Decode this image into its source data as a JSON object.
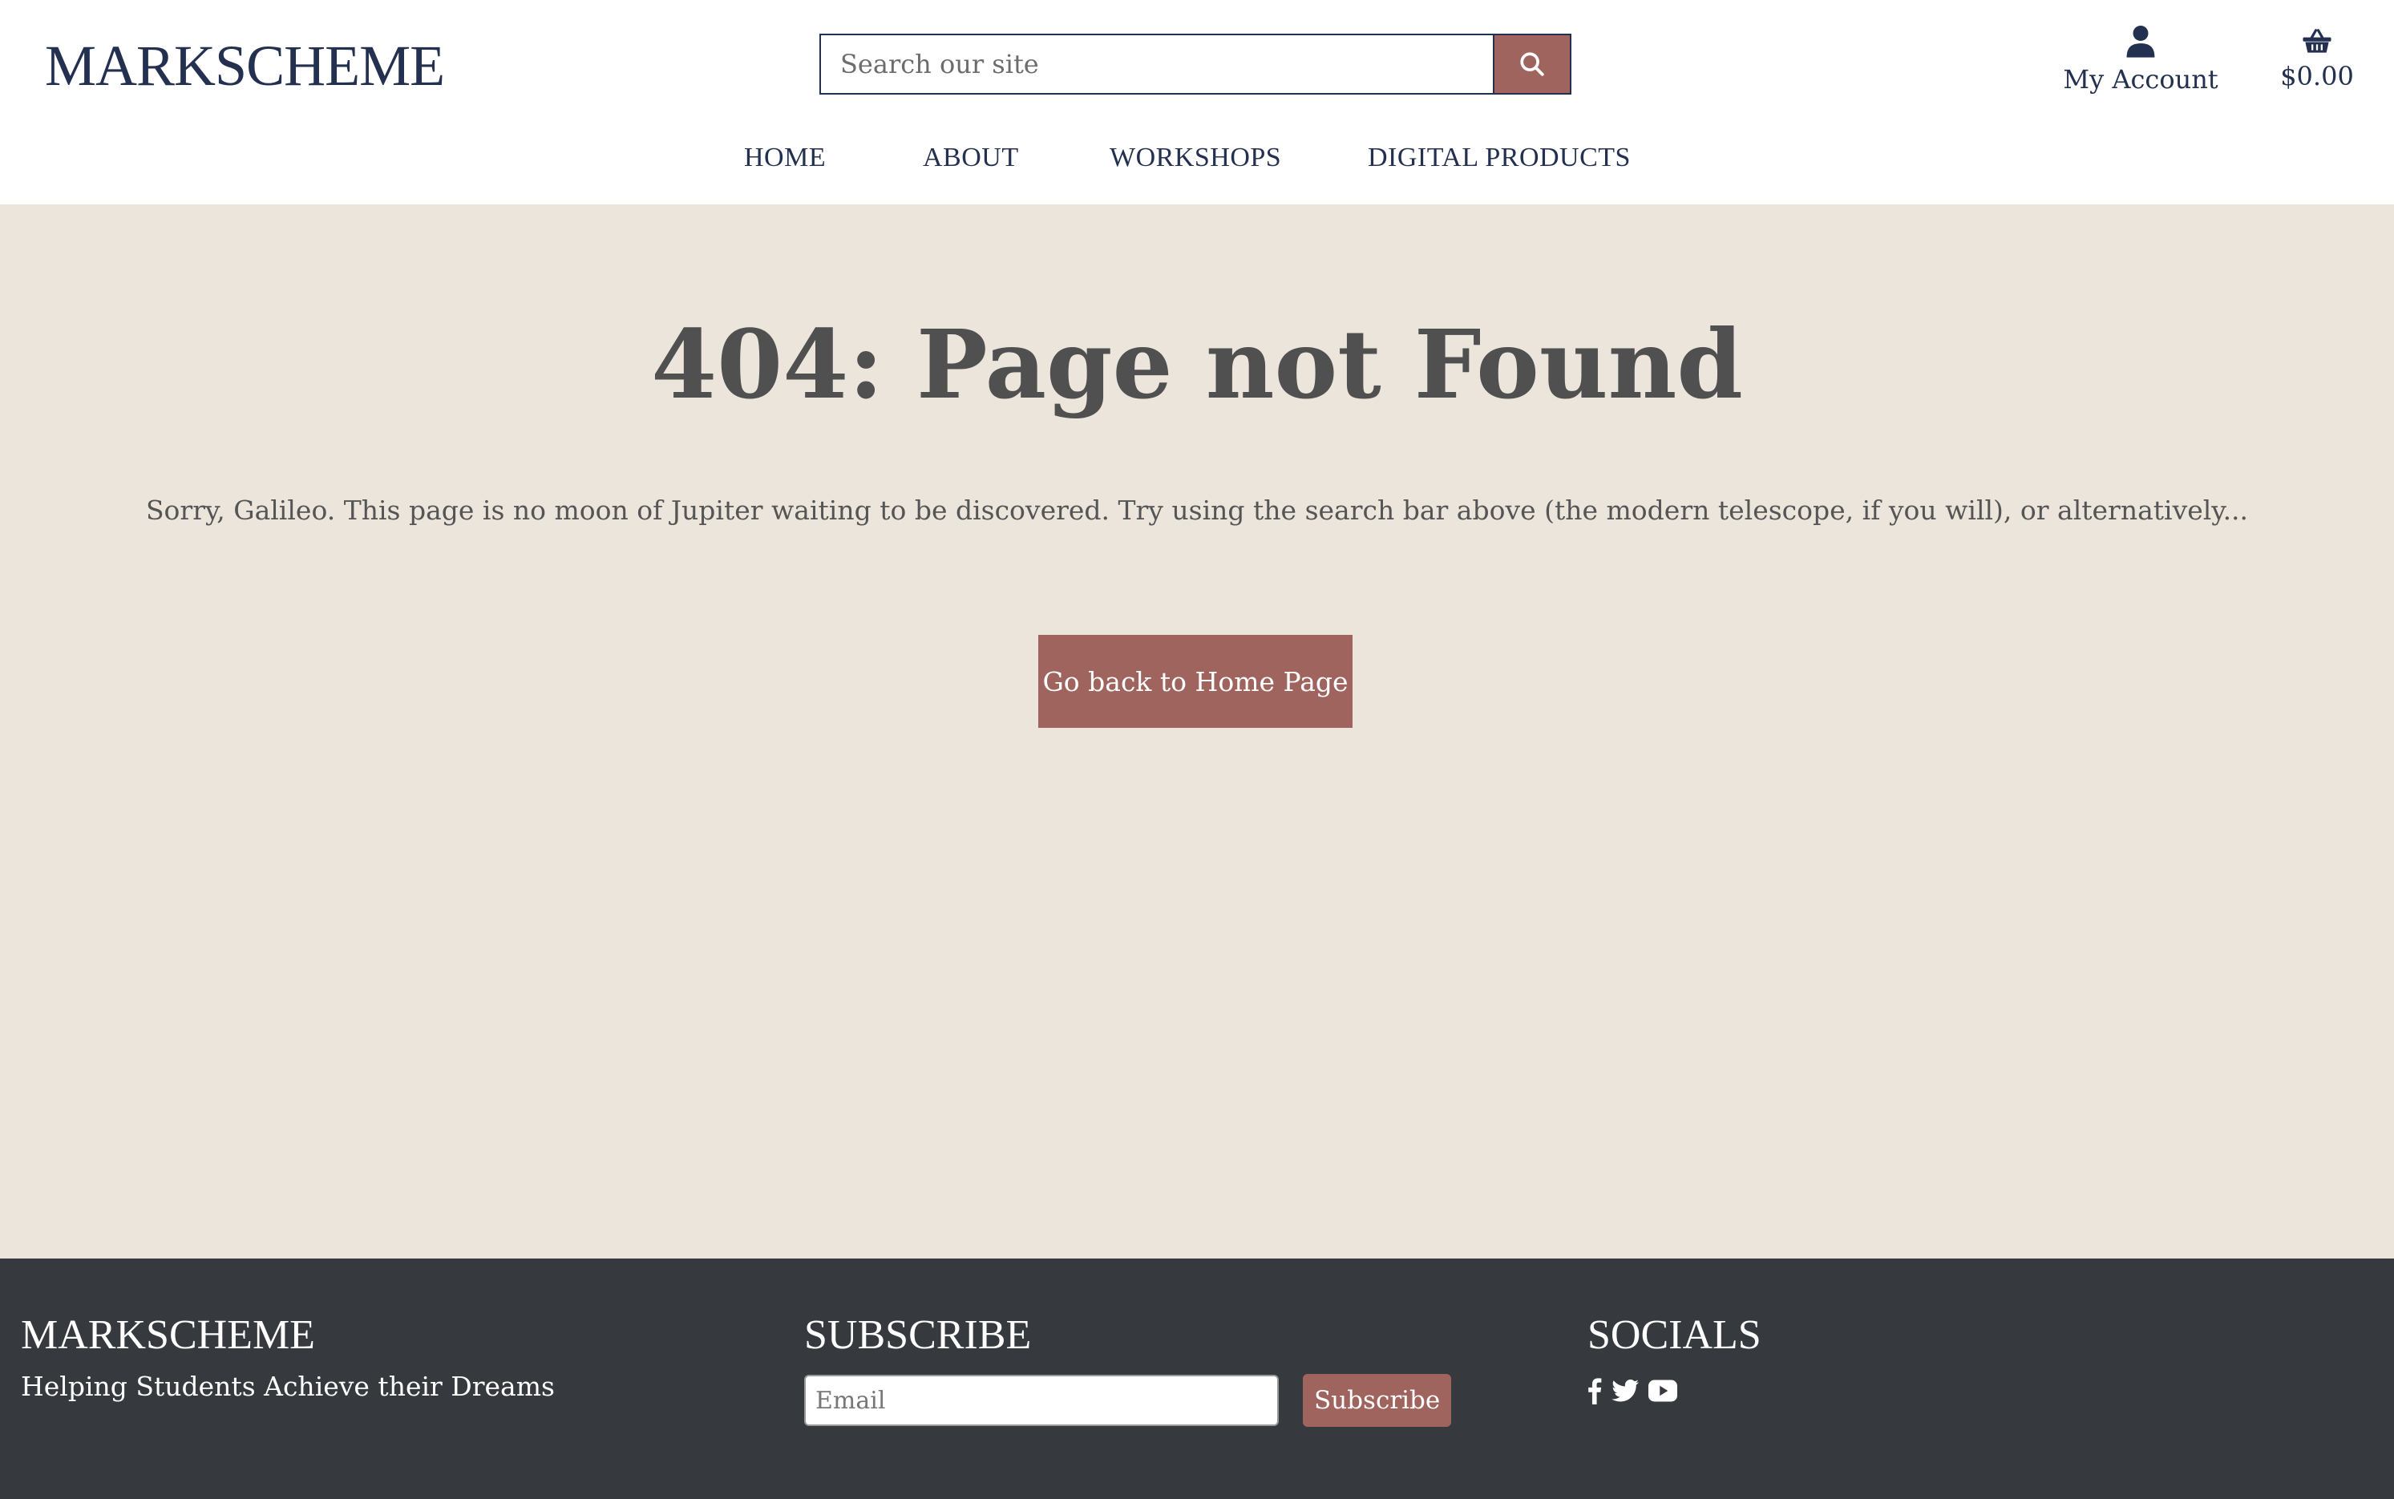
{
  "header": {
    "logo": "MARKSCHEME",
    "search": {
      "placeholder": "Search our site",
      "value": ""
    },
    "account_label": "My Account",
    "cart_total": "$0.00",
    "nav": [
      "HOME",
      "ABOUT",
      "WORKSHOPS",
      "DIGITAL PRODUCTS"
    ]
  },
  "main": {
    "title": "404: Page not Found",
    "message": "Sorry, Galileo. This page is no moon of Jupiter waiting to be discovered. Try using the search bar above (the modern telescope, if you will), or alternatively...",
    "home_button": "Go back to Home Page"
  },
  "footer": {
    "brand": "MARKSCHEME",
    "tagline": "Helping Students Achieve their Dreams",
    "subscribe_heading": "SUBSCRIBE",
    "email_placeholder": "Email",
    "subscribe_button": "Subscribe",
    "socials_heading": "SOCIALS",
    "social_icons": [
      "facebook-icon",
      "twitter-icon",
      "youtube-icon"
    ]
  },
  "colors": {
    "navy": "#23304f",
    "accent": "#a0645f",
    "beige": "#ece5dc",
    "footer": "#363a3f",
    "title_gray": "#505050"
  }
}
